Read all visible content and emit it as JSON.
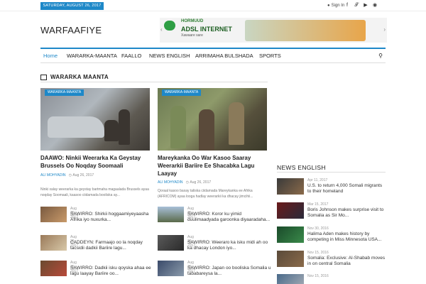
{
  "topbar": {
    "date": "SATURDAY, AUGUST 26, 2017",
    "signin_label": "Sign In",
    "social_icons": [
      "facebook-icon",
      "twitter-icon",
      "youtube-icon",
      "instagram-icon"
    ]
  },
  "header": {
    "logo": "WARFAAFIYE",
    "banner": {
      "line1": "HORMUUD",
      "line2": "ADSL INTERNET",
      "line3": "Xawaare sare"
    }
  },
  "nav": {
    "items": [
      "Home",
      "WARARKA-MAANTA",
      "FAALLO",
      "NEWS ENGLISH",
      "ARRIMAHA BULSHADA",
      "SPORTS"
    ],
    "active": "Home"
  },
  "section": {
    "title": "WARARKA MAANTA"
  },
  "featured": [
    {
      "category": "WARARKA-MAANTA",
      "title": "DAAWO: Ninkii Weerarka Ka Geystay Brussels Oo Noqday Soomaali",
      "author": "ALI MOHYADIN",
      "date": "Aug 26, 2017",
      "excerpt": "Ninki xalay weerarka ka geystay bartmaha magaalada Brussels ayaa noqday Soomaali, kaasoo ciidamada booliska ay..."
    },
    {
      "category": "WARARKA-MAANTA",
      "title": "Mareykanka Oo War Kasoo Saaray Weerarkii Bariire Ee Shacabka Lagu Laayay",
      "author": "ALI MOHYADIN",
      "date": "Aug 26, 2017",
      "excerpt": "Qoraal kasoo baxay taliska ciidamada Mareykanka ee Afrika (AFRICOM) ayaa looga hadlay weerarkii ka dhacay jimcihii..."
    }
  ],
  "list_left": [
    {
      "date": "Aug 26, 2017",
      "title": "SAWIRRO: Shirkii hoggaamiyeyaasha Afrika iyo nuxurka..."
    },
    {
      "date": "Aug 26, 2017",
      "title": "CADDEYN: Farmaajo oo la noqday tacsidii dadkii Bariire lagu..."
    },
    {
      "date": "Aug 25, 2017",
      "title": "SAWIRRO: Dadkii isku qoyska ahaa ee lagu laayay Bariire oo..."
    }
  ],
  "list_right": [
    {
      "date": "Aug 26, 2017",
      "title": "SAWIRRO: Koror ku yimid duulimaadyada garoonka diyaaradaha..."
    },
    {
      "date": "Aug 26, 2017",
      "title": "SAWIRRO: Weeraro ka isku midi ah oo ka dhacay London iyo..."
    },
    {
      "date": "Aug 25, 2017",
      "title": "SAWIRRO: Japan oo booliska Somalia u tababareysa la..."
    }
  ],
  "sidebar": {
    "title": "NEWS ENGLISH",
    "items": [
      {
        "date": "Apr 11, 2017",
        "title": "U.S. to return 4,000 Somali migrants to their homeland"
      },
      {
        "date": "Mar 15, 2017",
        "title": "Boris Johnson makes surprise visit to Somalia as Sir Mo..."
      },
      {
        "date": "Nov 30, 2016",
        "title": "Halima Aden makes history by competing in Miss Minnesota USA..."
      },
      {
        "date": "Nov 15, 2016",
        "title": "Somalia: Exclusive: Al-Shabab moves in on central Somalia"
      },
      {
        "date": "Nov 15, 2016",
        "title": ""
      }
    ]
  },
  "colors": {
    "accent": "#1e88c8",
    "text": "#222222",
    "muted": "#888888"
  }
}
